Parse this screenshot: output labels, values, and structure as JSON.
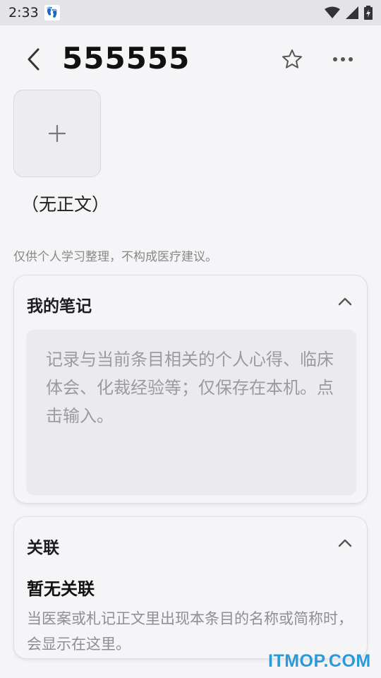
{
  "status_bar": {
    "time": "2:33"
  },
  "header": {
    "title": "555555"
  },
  "content": {
    "add_image_icon": "plus-icon",
    "no_body_text": "（无正文）",
    "disclaimer": "仅供个人学习整理，不构成医疗建议。"
  },
  "notes_card": {
    "title": "我的笔记",
    "placeholder": "记录与当前条目相关的个人心得、临床体会、化裁经验等；仅保存在本机。点击输入。"
  },
  "links_card": {
    "title": "关联",
    "empty_title": "暂无关联",
    "empty_desc": "当医案或札记正文里出现本条目的名称或简称时，会显示在这里。"
  },
  "watermark": "ITMOP.COM",
  "colors": {
    "background": "#f5f5f8",
    "accent_watermark": "#2a9bd8"
  }
}
